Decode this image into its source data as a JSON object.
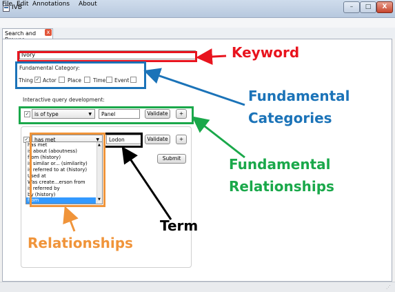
{
  "window": {
    "title": "IVB"
  },
  "window_controls": {
    "minimize": "–",
    "maximize": "□",
    "close": "X"
  },
  "menu": [
    "File",
    "Edit",
    "Annotations",
    "About"
  ],
  "tab": {
    "label": "Search and Browse",
    "close": "x"
  },
  "keyword_input": {
    "value": "Ivory"
  },
  "fundamental_category": {
    "label": "Fundamental Category:",
    "options": [
      {
        "label": "Thing",
        "checked": true
      },
      {
        "label": "Actor",
        "checked": false
      },
      {
        "label": "Place",
        "checked": false
      },
      {
        "label": "Time",
        "checked": false
      },
      {
        "label": "Event",
        "checked": false
      }
    ]
  },
  "query": {
    "label": "Interactive query development:",
    "row1": {
      "checked": true,
      "relation": "is of type",
      "term": "Panel",
      "validate": "Validate",
      "add": "+"
    },
    "row2": {
      "checked": true,
      "relation": "has met",
      "term": "Lodon",
      "validate": "Validate",
      "add": "+"
    },
    "submit": "Submit",
    "dropdown_items": [
      "has met",
      "is about (aboutness)",
      "from (history)",
      "is similar or... (similarity)",
      "is referred to at (history)",
      "Used at",
      "Was create...erson from",
      "is referred by",
      "by (history)",
      "from"
    ],
    "selected_index": 9
  },
  "annotations": {
    "keyword": "Keyword",
    "categories_line1": "Fundamental",
    "categories_line2": "Categories",
    "relationships_line1": "Fundamental",
    "relationships_line2": "Relationships",
    "term": "Term",
    "relationships": "Relationships"
  },
  "colors": {
    "red": "#e8141e",
    "blue": "#1b73b8",
    "green": "#1aa84a",
    "black": "#000000",
    "orange": "#f0943a",
    "selection": "#3399ff"
  }
}
